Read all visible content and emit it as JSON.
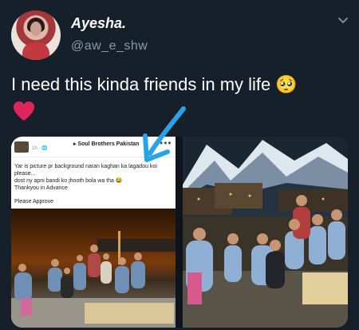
{
  "tweet": {
    "display_name": "Ayesha.",
    "handle": "@aw_e_shw",
    "text": "I need this kinda friends in my life 🥺",
    "emoji_heart": "red-heart-icon"
  },
  "media": {
    "left_post": {
      "page_name": "▸ Soul Brothers Pakistan",
      "time": "1h · 🌐",
      "menu": "•••",
      "lines": [
        "Yar is picture pr background naran kaghan ka lagadou koi",
        "please...",
        "dost ny apni bandi ko jhooth bola wa tha 😂",
        "Thankyou in Advance"
      ],
      "footer": "Please Approve"
    }
  },
  "colors": {
    "background": "#15202b",
    "secondary_text": "#8899a6",
    "heart": "#e0245e",
    "arrow": "#2aa3e6"
  }
}
